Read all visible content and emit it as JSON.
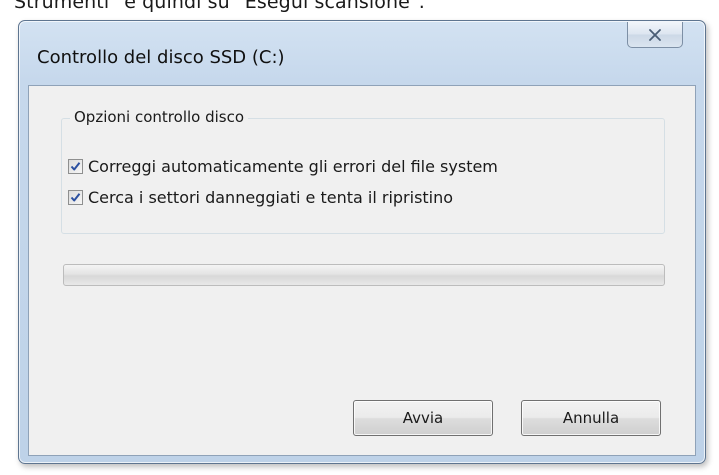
{
  "caption": {
    "text": "Strumenti\" e quindi su \"Esegui scansione\"."
  },
  "window": {
    "title": "Controllo del disco SSD (C:)",
    "close_icon": "close-x-icon"
  },
  "options": {
    "legend": "Opzioni controllo disco",
    "items": [
      {
        "label": "Correggi automaticamente gli errori del file system",
        "checked": true
      },
      {
        "label": "Cerca i settori danneggiati e tenta il ripristino",
        "checked": true
      }
    ]
  },
  "progress": {
    "value_percent": 0
  },
  "buttons": {
    "start_label": "Avvia",
    "cancel_label": "Annulla"
  },
  "colors": {
    "frame": "#c6d8ec",
    "client": "#f0f0f0",
    "checkmark": "#2a4fa0"
  }
}
